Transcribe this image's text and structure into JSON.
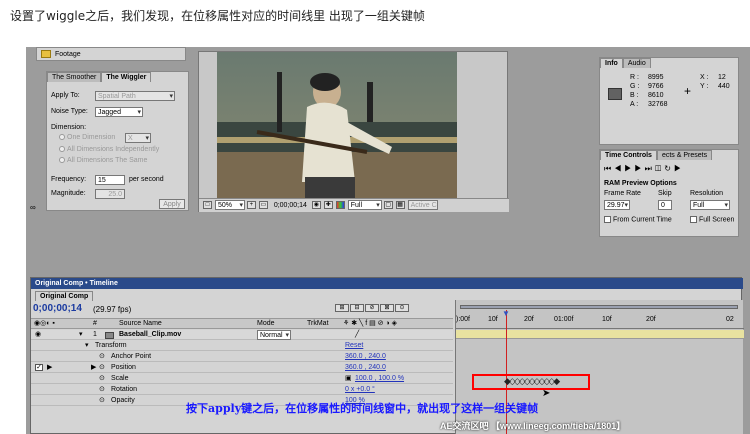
{
  "caption": "设置了wiggle之后，我们发现，在位移属性对应的时间线里 出现了一组关键帧",
  "project": {
    "folder": "Footage"
  },
  "wiggler": {
    "tabs": [
      "The Smoother",
      "The Wiggler"
    ],
    "apply_to_label": "Apply To:",
    "apply_to_value": "Spatial Path",
    "noise_label": "Noise Type:",
    "noise_value": "Jagged",
    "dimension_label": "Dimension:",
    "one_dim": "One Dimension",
    "one_dim_axis": "X",
    "all_indep": "All Dimensions Independently",
    "all_same": "All Dimensions The Same",
    "freq_label": "Frequency:",
    "freq_value": "15",
    "freq_unit": "per second",
    "mag_label": "Magnitude:",
    "mag_value": "25.0",
    "apply_button": "Apply"
  },
  "viewer": {
    "zoom": "50%",
    "timecode": "0;00;00;14",
    "resolution": "Full",
    "camera": "Active C"
  },
  "info": {
    "tabs": [
      "Info",
      "Audio"
    ],
    "r_label": "R :",
    "r_value": "8995",
    "g_label": "G :",
    "g_value": "9766",
    "b_label": "B :",
    "b_value": "8610",
    "a_label": "A :",
    "a_value": "32768",
    "x_label": "X :",
    "x_value": "12",
    "y_label": "Y :",
    "y_value": "440"
  },
  "time_controls": {
    "tabs": [
      "Time Controls",
      "ects & Presets"
    ],
    "ram_title": "RAM Preview Options",
    "frame_rate_label": "Frame Rate",
    "frame_rate_value": "29.97",
    "skip_label": "Skip",
    "skip_value": "0",
    "resolution_label": "Resolution",
    "resolution_value": "Full",
    "from_current": "From Current Time",
    "full_screen": "Full Screen"
  },
  "timeline": {
    "title": "Original Comp • Timeline",
    "comp_tab": "Original Comp",
    "time": "0;00;00;14",
    "fps": "(29.97 fps)",
    "col_num": "#",
    "col_source": "Source Name",
    "col_mode": "Mode",
    "col_trkmat": "TrkMat",
    "ruler": [
      "):00f",
      "10f",
      "20f",
      "01:00f",
      "10f",
      "20f",
      "02"
    ],
    "layer": {
      "num": "1",
      "name": "Baseball_Clip.mov",
      "mode": "Normal"
    },
    "transform": "Transform",
    "reset": "Reset",
    "props": [
      {
        "name": "Anchor Point",
        "value": "360.0 , 240.0"
      },
      {
        "name": "Position",
        "value": "360.0 , 240.0"
      },
      {
        "name": "Scale",
        "value": "100.0 , 100.0 %"
      },
      {
        "name": "Rotation",
        "value": "0 x +0.0 °"
      },
      {
        "name": "Opacity",
        "value": "100 %"
      }
    ]
  },
  "annotation": "按下apply键之后，在位移属性的时间线窗中，就出现了这样一组关键帧",
  "watermark": "AE交流区吧 【www.lineeg.com/tieba/1801】",
  "colors": {
    "annotation": "#1a1aff",
    "keyframe_box": "#ff0000",
    "timeline_title_bar": "#2a4a8a",
    "time_blue": "#1a3aa0"
  }
}
